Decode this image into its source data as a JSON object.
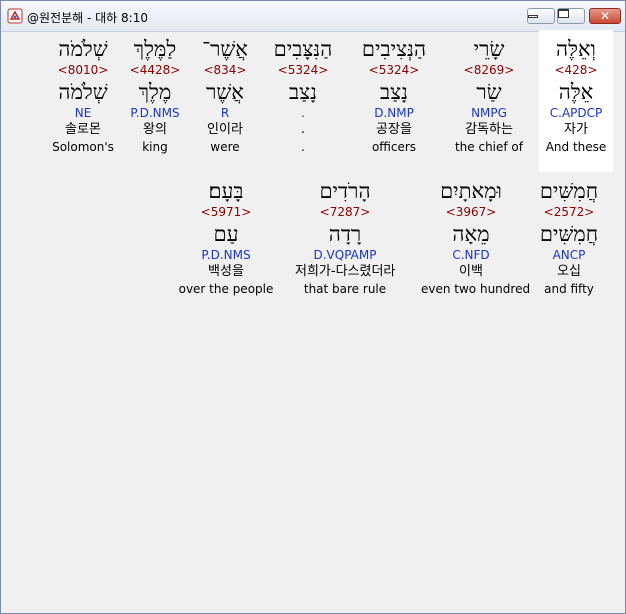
{
  "window": {
    "title": "@원전분해 - 대하 8:10"
  },
  "rows": [
    {
      "words": [
        {
          "hebrew": "וְאֵלֶּה",
          "strong": "<428>",
          "lemma": "אֵלֶּה",
          "parse": "C.APDCP",
          "korean": "자가",
          "english": "And these",
          "highlight": true
        },
        {
          "hebrew": "שָׂרֵי",
          "strong": "<8269>",
          "lemma": "שַׂר",
          "parse": "NMPG",
          "korean": "감독하는",
          "english": "the chief of"
        },
        {
          "hebrew": "הַנְּצִיבִים",
          "strong": "<5324>",
          "lemma": "נָצַב",
          "parse": "D.NMP",
          "korean": "공장을",
          "english": "officers"
        },
        {
          "hebrew": "הַנִּצָּבִים",
          "strong": "<5324>",
          "lemma": "נָצַב",
          "parse": ".",
          "korean": ".",
          "english": "."
        },
        {
          "hebrew": "אֲשֶׁר־",
          "strong": "<834>",
          "lemma": "אֲשֶׁר",
          "parse": "R",
          "korean": "인이라",
          "english": "were"
        },
        {
          "hebrew": "לַמֶּלֶךְ",
          "strong": "<4428>",
          "lemma": "מֶלֶךְ",
          "parse": "P.D.NMS",
          "korean": "왕의",
          "english": "king"
        },
        {
          "hebrew": "שְׁלֹמֹה",
          "strong": "<8010>",
          "lemma": "שְׁלֹמֹה",
          "parse": "NE",
          "korean": "솔로몬",
          "english": "Solomon's"
        }
      ]
    },
    {
      "words": [
        {
          "hebrew": "חֲמִשִּׁים",
          "strong": "<2572>",
          "lemma": "חֲמִשִּׁים",
          "parse": "ANCP",
          "korean": "오십",
          "english": "and fifty"
        },
        {
          "hebrew": "וּמָאתָיִם",
          "strong": "<3967>",
          "lemma": "מֵאָה",
          "parse": "C.NFD",
          "korean": "이백",
          "english": "even two hundred"
        },
        {
          "hebrew": "הָרֹדִים",
          "strong": "<7287>",
          "lemma": "רָדָה",
          "parse": "D.VQPAMP",
          "korean": "저희가-다스렸더라",
          "english": "that bare rule"
        },
        {
          "hebrew": "בָּעָם׃",
          "strong": "<5971>",
          "lemma": "עַם",
          "parse": "P.D.NMS",
          "korean": "백성을",
          "english": "over the people"
        }
      ]
    }
  ]
}
